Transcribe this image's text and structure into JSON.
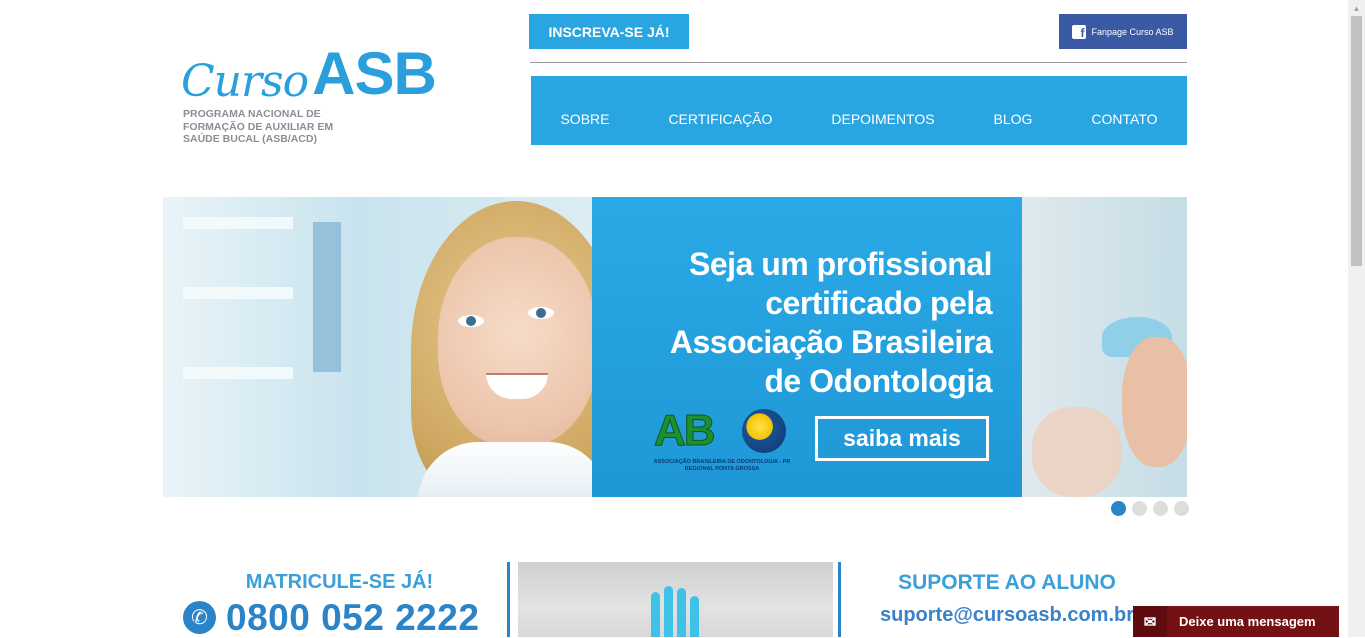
{
  "logo": {
    "curso": "Curso",
    "asb": "ASB",
    "tagline": "PROGRAMA NACIONAL DE FORMAÇÃO DE AUXILIAR EM SAÚDE BUCAL (ASB/ACD)"
  },
  "header": {
    "inscreva_label": "INSCREVA-SE JÁ!",
    "fanpage_label": "Fanpage Curso ASB",
    "fanpage_icon_letter": "f"
  },
  "nav": {
    "items": [
      {
        "label": "SOBRE"
      },
      {
        "label": "CERTIFICAÇÃO"
      },
      {
        "label": "DEPOIMENTOS"
      },
      {
        "label": "BLOG"
      },
      {
        "label": "CONTATO"
      }
    ]
  },
  "banner": {
    "headline_lines": [
      "Seja um profissional",
      "certificado pela",
      "Associação Brasileira",
      "de Odontologia"
    ],
    "abo_logo_text": "AB",
    "abo_caption_line1": "ASSOCIAÇÃO BRASILEIRA DE ODONTOLOGIA - PR",
    "abo_caption_line2": "REGIONAL PONTA GROSSA",
    "cta_label": "saiba mais",
    "slides_total": 4,
    "active_slide": 1
  },
  "matricule": {
    "title": "MATRICULE-SE JÁ!",
    "phone": "0800 052 2222",
    "phone_icon": "✆"
  },
  "suporte": {
    "title": "SUPORTE AO ALUNO",
    "email": "suporte@cursoasb.com.br"
  },
  "chat": {
    "label": "Deixe uma mensagem",
    "icon": "✉"
  },
  "colors": {
    "brand_blue": "#29a5e1",
    "dark_blue": "#2a84c8",
    "facebook": "#3b5aa5",
    "chat_bg": "#731114"
  }
}
